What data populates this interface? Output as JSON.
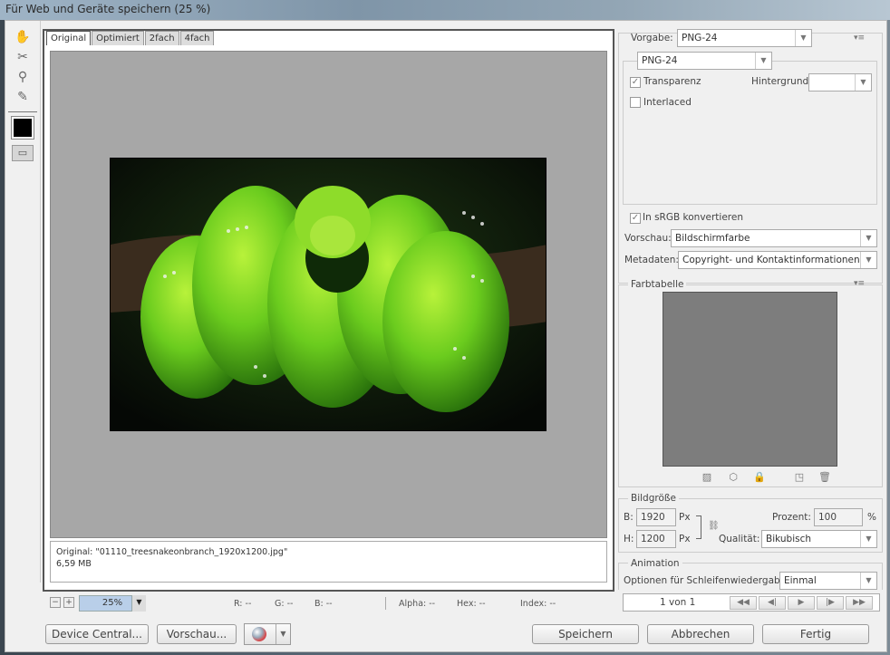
{
  "window": {
    "title": "Für Web und Geräte speichern (25 %)"
  },
  "tools": {
    "hand": "hand-icon",
    "slice": "slice-select-icon",
    "zoom": "zoom-icon",
    "eyedropper": "eyedropper-icon",
    "preview": "slice-visibility-icon"
  },
  "tabs": [
    {
      "label": "Original"
    },
    {
      "label": "Optimiert"
    },
    {
      "label": "2fach"
    },
    {
      "label": "4fach"
    }
  ],
  "info": {
    "line1": "Original: \"01110_treesnakeonbranch_1920x1200.jpg\"",
    "line2": "6,59 MB"
  },
  "status": {
    "zoom": "25%",
    "r": "R: --",
    "g": "G: --",
    "b": "B: --",
    "alpha": "Alpha: --",
    "hex": "Hex: --",
    "index": "Index: --"
  },
  "buttons": {
    "device_central": "Device Central...",
    "preview": "Vorschau...",
    "save": "Speichern",
    "cancel": "Abbrechen",
    "done": "Fertig"
  },
  "settings": {
    "preset_label": "Vorgabe:",
    "preset_value": "PNG-24",
    "format_value": "PNG-24",
    "transparency_label": "Transparenz",
    "background_label": "Hintergrund:",
    "interlaced_label": "Interlaced",
    "srgb_label": "In sRGB konvertieren",
    "preview_label": "Vorschau:",
    "preview_value": "Bildschirmfarbe",
    "metadata_label": "Metadaten:",
    "metadata_value": "Copyright- und Kontaktinformationen"
  },
  "colortable": {
    "title": "Farbtabelle"
  },
  "imagesize": {
    "title": "Bildgröße",
    "w_label": "B:",
    "w_value": "1920",
    "h_label": "H:",
    "h_value": "1200",
    "unit": "Px",
    "percent_label": "Prozent:",
    "percent_value": "100",
    "percent_unit": "%",
    "quality_label": "Qualität:",
    "quality_value": "Bikubisch"
  },
  "animation": {
    "title": "Animation",
    "loop_label": "Optionen für Schleifenwiedergabe:",
    "loop_value": "Einmal",
    "frame_counter": "1 von 1"
  },
  "colors": {
    "snake": "#7fd62a",
    "background": "#0e160a",
    "canvas": "#a7a7a7"
  }
}
